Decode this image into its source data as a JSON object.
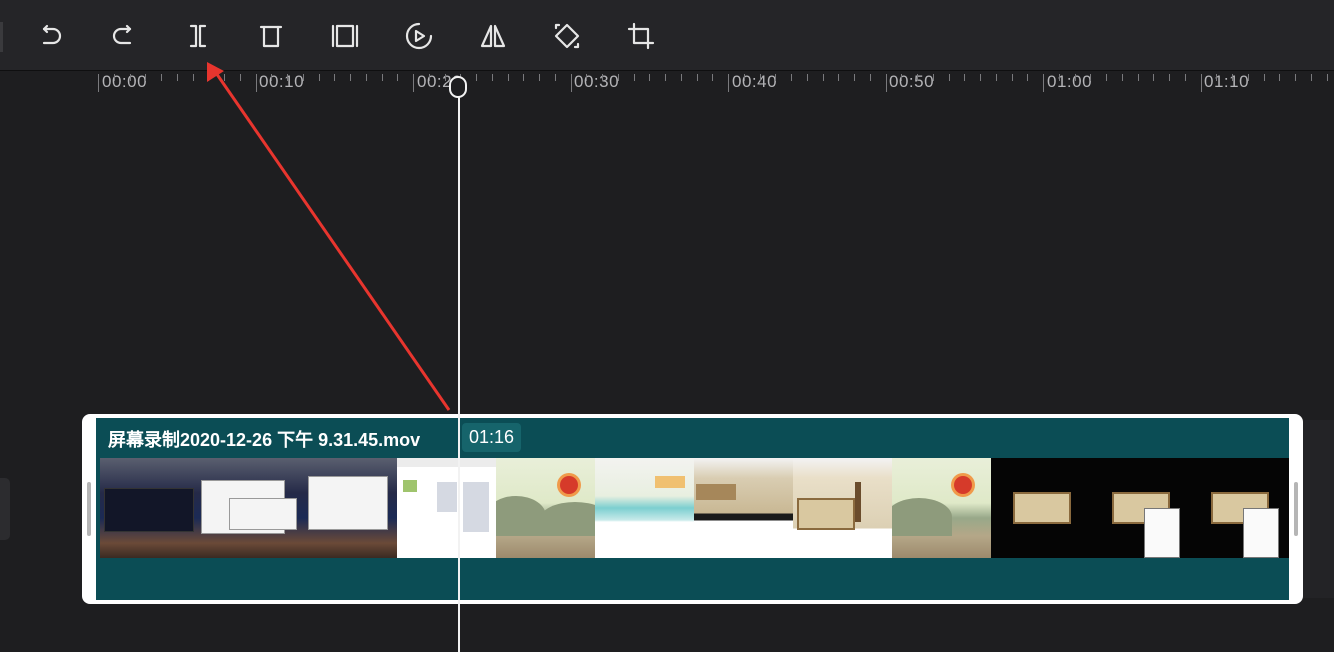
{
  "toolbar": {
    "tools": [
      {
        "name": "undo",
        "icon": "undo-icon"
      },
      {
        "name": "redo",
        "icon": "redo-icon"
      },
      {
        "name": "split",
        "icon": "split-icon"
      },
      {
        "name": "delete",
        "icon": "delete-icon"
      },
      {
        "name": "freeze-frame",
        "icon": "freeze-frame-icon"
      },
      {
        "name": "speed",
        "icon": "play-speed-icon"
      },
      {
        "name": "mirror",
        "icon": "mirror-icon"
      },
      {
        "name": "rotate",
        "icon": "rotate-icon"
      },
      {
        "name": "crop",
        "icon": "crop-icon"
      }
    ]
  },
  "timeline": {
    "ruler_labels": [
      "00:00",
      "00:10",
      "00:20",
      "00:30",
      "00:40",
      "00:50",
      "01:00",
      "01:10"
    ],
    "playhead_time": "00:20"
  },
  "clip": {
    "title": "屏幕录制2020-12-26 下午 9.31.45.mov",
    "duration": "01:16"
  },
  "annotation": {
    "arrow_color": "#e8352e"
  },
  "colors": {
    "background": "#1e1e20",
    "clip_fill": "#0b4d55",
    "clip_border": "#ffffff"
  }
}
